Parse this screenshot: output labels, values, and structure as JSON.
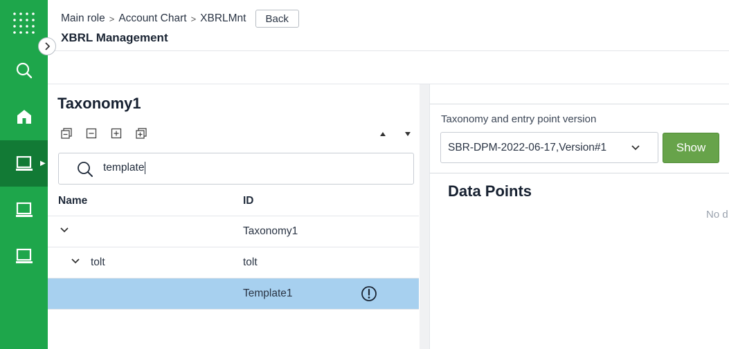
{
  "header": {
    "breadcrumb": [
      "Main role",
      "Account Chart",
      "XBRLMnt"
    ],
    "breadcrumb_separator": ">",
    "back_label": "Back",
    "title": "XBRL Management"
  },
  "sidebar": {
    "items": [
      {
        "icon": "apps-grid-icon"
      },
      {
        "icon": "search-icon"
      },
      {
        "icon": "home-icon"
      },
      {
        "icon": "laptop-icon",
        "active": true
      },
      {
        "icon": "laptop-icon"
      },
      {
        "icon": "laptop-icon"
      }
    ],
    "colors": {
      "background": "#1ea64b",
      "active": "#127a35"
    }
  },
  "tree": {
    "title": "Taxonomy1",
    "search_value": "template",
    "columns": {
      "name": "Name",
      "id": "ID"
    },
    "rows": [
      {
        "name": "",
        "id": "Taxonomy1",
        "expanded": true,
        "level": 0
      },
      {
        "name": "tolt",
        "id": "tolt",
        "expanded": true,
        "level": 1
      },
      {
        "name": "",
        "id": "Template1",
        "selected": true,
        "level": 2,
        "icon": "warning-circle-icon"
      }
    ]
  },
  "right": {
    "version_label": "Taxonomy and entry point version",
    "version_value": "SBR-DPM-2022-06-17,Version#1",
    "show_label": "Show",
    "data_points_title": "Data Points",
    "no_data": "No d"
  },
  "colors": {
    "accent_green": "#67a34a",
    "selected_row": "#a7d0ef"
  }
}
